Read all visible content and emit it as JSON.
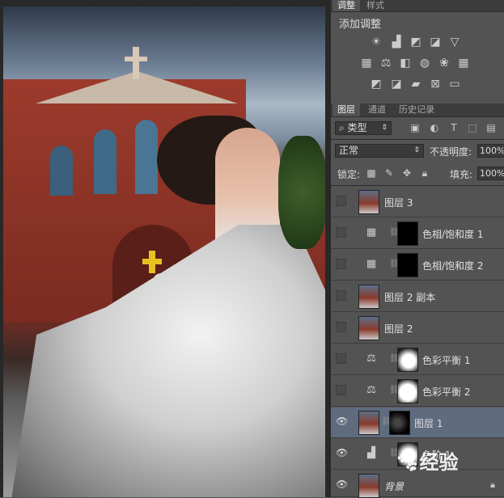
{
  "adjust_tabs": [
    "调整",
    "样式"
  ],
  "add_adjustment_label": "添加调整",
  "adjustment_icons": [
    [
      "brightness-icon",
      "levels-icon",
      "curves-icon",
      "exposure-icon",
      "vibrance-icon"
    ],
    [
      "hue-sat-icon",
      "color-balance-icon",
      "black-white-icon",
      "photo-filter-icon",
      "channel-mixer-icon",
      "color-lookup-icon"
    ],
    [
      "invert-icon",
      "posterize-icon",
      "threshold-icon",
      "selective-color-icon",
      "gradient-map-icon"
    ]
  ],
  "layers_tabs": [
    "图层",
    "通道",
    "历史记录"
  ],
  "filter": {
    "kind": "类型"
  },
  "blend": {
    "mode": "正常",
    "opacity_label": "不透明度:",
    "opacity": "100%"
  },
  "lock": {
    "label": "锁定:",
    "fill_label": "填充:",
    "fill": "100%"
  },
  "layers": [
    {
      "name": "图层 3",
      "visible": false,
      "selected": false
    },
    {
      "name": "色相/饱和度 1",
      "visible": false,
      "selected": false
    },
    {
      "name": "色相/饱和度 2",
      "visible": false,
      "selected": false
    },
    {
      "name": "图层 2 副本",
      "visible": false,
      "selected": false
    },
    {
      "name": "图层 2",
      "visible": false,
      "selected": false
    },
    {
      "name": "色彩平衡 1",
      "visible": false,
      "selected": false
    },
    {
      "name": "色彩平衡 2",
      "visible": false,
      "selected": false
    },
    {
      "name": "图层 1",
      "visible": true,
      "selected": true
    },
    {
      "name": "色阶 1",
      "visible": true,
      "selected": false
    },
    {
      "name": "背景",
      "visible": true,
      "selected": false
    }
  ],
  "watermark": "经验"
}
